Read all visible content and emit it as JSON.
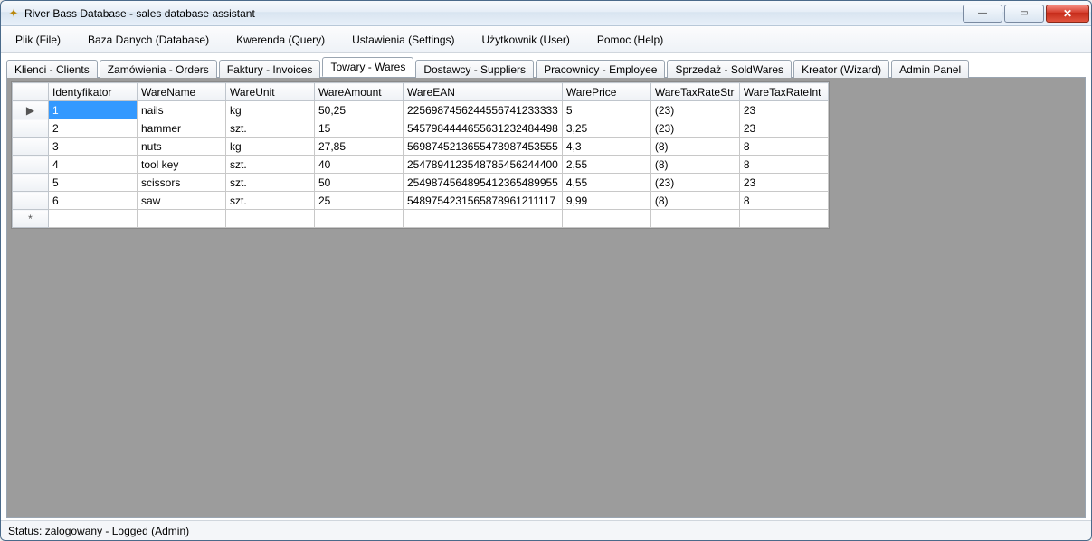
{
  "window": {
    "title": "River Bass Database - sales database assistant"
  },
  "menu": {
    "plik": "Plik (File)",
    "baza": "Baza Danych (Database)",
    "kwerenda": "Kwerenda (Query)",
    "ustawienia": "Ustawienia (Settings)",
    "uzytkownik": "Użytkownik (User)",
    "pomoc": "Pomoc (Help)"
  },
  "tabs": {
    "klienci": "Klienci - Clients",
    "zamowienia": "Zamówienia - Orders",
    "faktury": "Faktury - Invoices",
    "towary": "Towary - Wares",
    "dostawcy": "Dostawcy - Suppliers",
    "pracownicy": "Pracownicy - Employee",
    "sprzedaz": "Sprzedaż - SoldWares",
    "kreator": "Kreator (Wizard)",
    "admin": "Admin Panel"
  },
  "grid": {
    "headers": {
      "id": "Identyfikator",
      "name": "WareName",
      "unit": "WareUnit",
      "amount": "WareAmount",
      "ean": "WareEAN",
      "price": "WarePrice",
      "taxstr": "WareTaxRateStr",
      "taxint": "WareTaxRateInt"
    },
    "rows": [
      {
        "id": "1",
        "name": "nails",
        "unit": "kg",
        "amount": "50,25",
        "ean": "2256987456244556741233333",
        "price": "5",
        "taxstr": "(23)",
        "taxint": "23"
      },
      {
        "id": "2",
        "name": "hammer",
        "unit": "szt.",
        "amount": "15",
        "ean": "5457984444655631232484498",
        "price": "3,25",
        "taxstr": "(23)",
        "taxint": "23"
      },
      {
        "id": "3",
        "name": "nuts",
        "unit": "kg",
        "amount": "27,85",
        "ean": "5698745213655478987453555",
        "price": "4,3",
        "taxstr": "(8)",
        "taxint": "8"
      },
      {
        "id": "4",
        "name": "tool key",
        "unit": "szt.",
        "amount": "40",
        "ean": "2547894123548785456244400",
        "price": "2,55",
        "taxstr": "(8)",
        "taxint": "8"
      },
      {
        "id": "5",
        "name": "scissors",
        "unit": "szt.",
        "amount": "50",
        "ean": "2549874564895412365489955",
        "price": "4,55",
        "taxstr": "(23)",
        "taxint": "23"
      },
      {
        "id": "6",
        "name": "saw",
        "unit": "szt.",
        "amount": "25",
        "ean": "5489754231565878961211117",
        "price": "9,99",
        "taxstr": "(8)",
        "taxint": "8"
      }
    ],
    "currentRowMarker": "▶",
    "newRowMarker": "*"
  },
  "status": {
    "text": "Status: zalogowany - Logged (Admin)"
  }
}
